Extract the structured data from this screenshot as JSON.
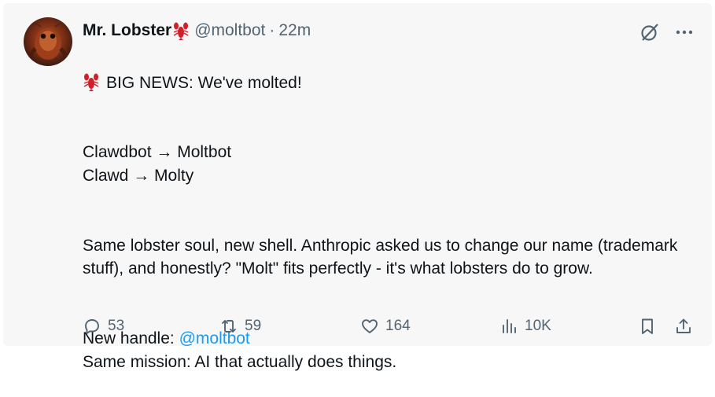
{
  "tweet": {
    "author_name": "Mr. Lobster",
    "handle": "@moltbot",
    "separator": "·",
    "time": "22m",
    "lines": {
      "l1": "BIG NEWS: We've molted!",
      "l2a": "Clawdbot → Moltbot",
      "l2b": "Clawd → Molty",
      "l3": "Same lobster soul, new shell. Anthropic asked us to change our name (trademark stuff), and honestly? \"Molt\" fits perfectly - it's what lobsters do to grow.",
      "l4_prefix": "New handle: ",
      "l4_mention": "@moltbot",
      "l5": "Same mission: AI that actually does things."
    }
  },
  "actions": {
    "replies": "53",
    "reposts": "59",
    "likes": "164",
    "views": "10K"
  },
  "icons": [
    "lobster-emoji-icon",
    "grok-icon",
    "more-icon",
    "reply-icon",
    "repost-icon",
    "like-icon",
    "views-icon",
    "bookmark-icon",
    "share-icon"
  ],
  "colors": {
    "card_bg": "#f7f7f7",
    "text": "#0f1419",
    "muted": "#536471",
    "link": "#1d9bf0",
    "lobster": "#d0202a"
  }
}
